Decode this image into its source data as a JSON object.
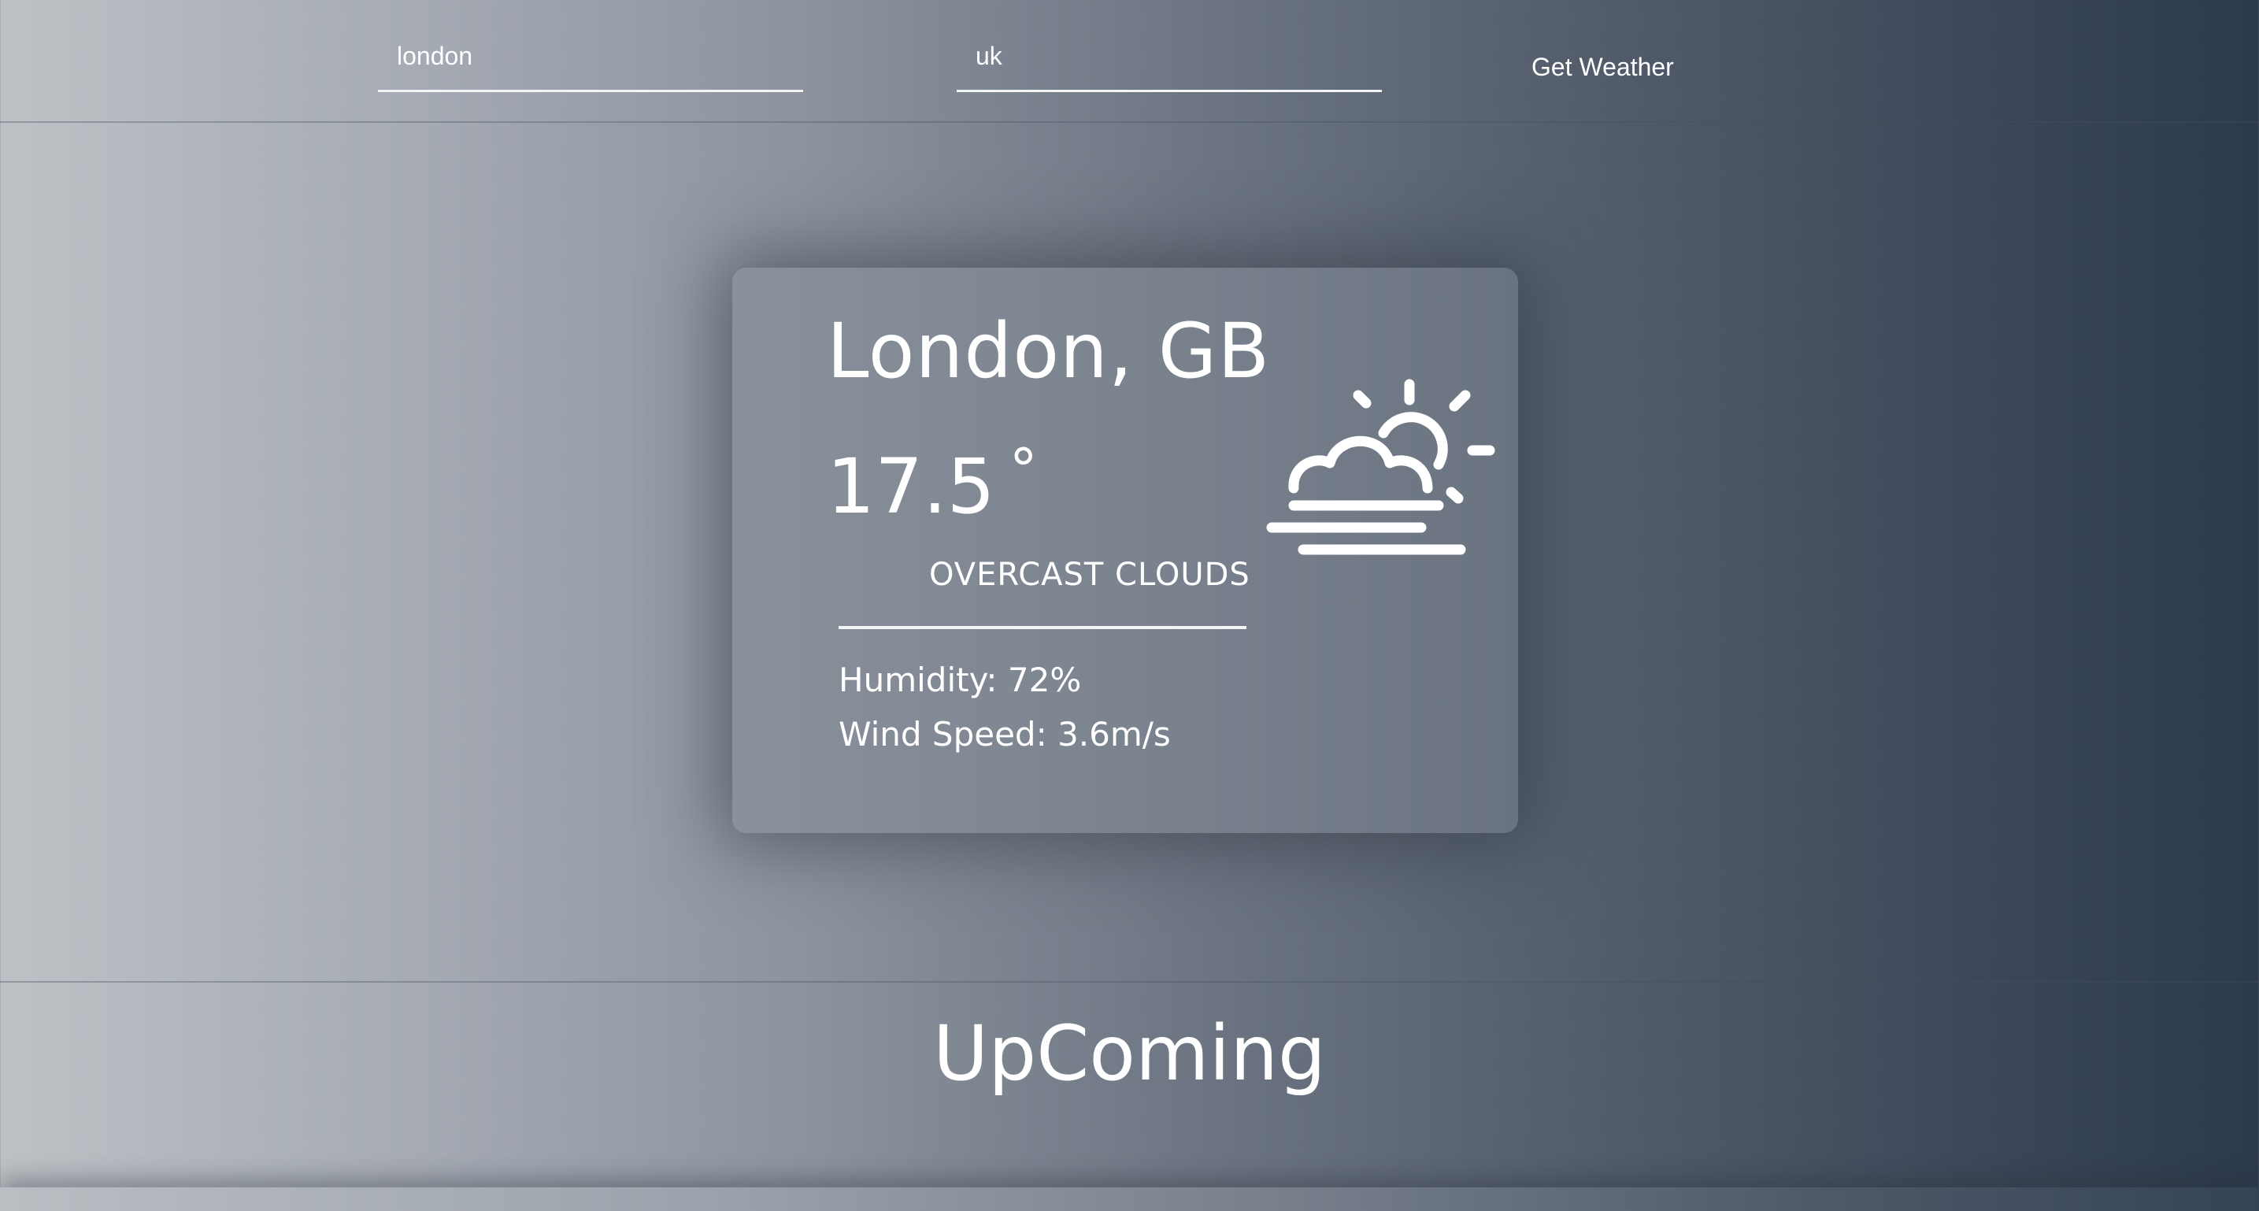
{
  "search": {
    "city_value": "london",
    "country_value": "uk",
    "button_label": "Get Weather"
  },
  "weather": {
    "location": "London, GB",
    "temperature": "17.5",
    "degree_symbol": "°",
    "description": "OVERCAST CLOUDS",
    "humidity": "Humidity: 72%",
    "wind_speed": "Wind Speed: 3.6m/s",
    "icon": "partly-cloudy-fog-icon"
  },
  "upcoming": {
    "title": "UpComing"
  },
  "colors": {
    "text": "#ffffff",
    "background_left": "#bcc1c5",
    "background_right": "#2c3a4c",
    "card": "#7d8591"
  }
}
